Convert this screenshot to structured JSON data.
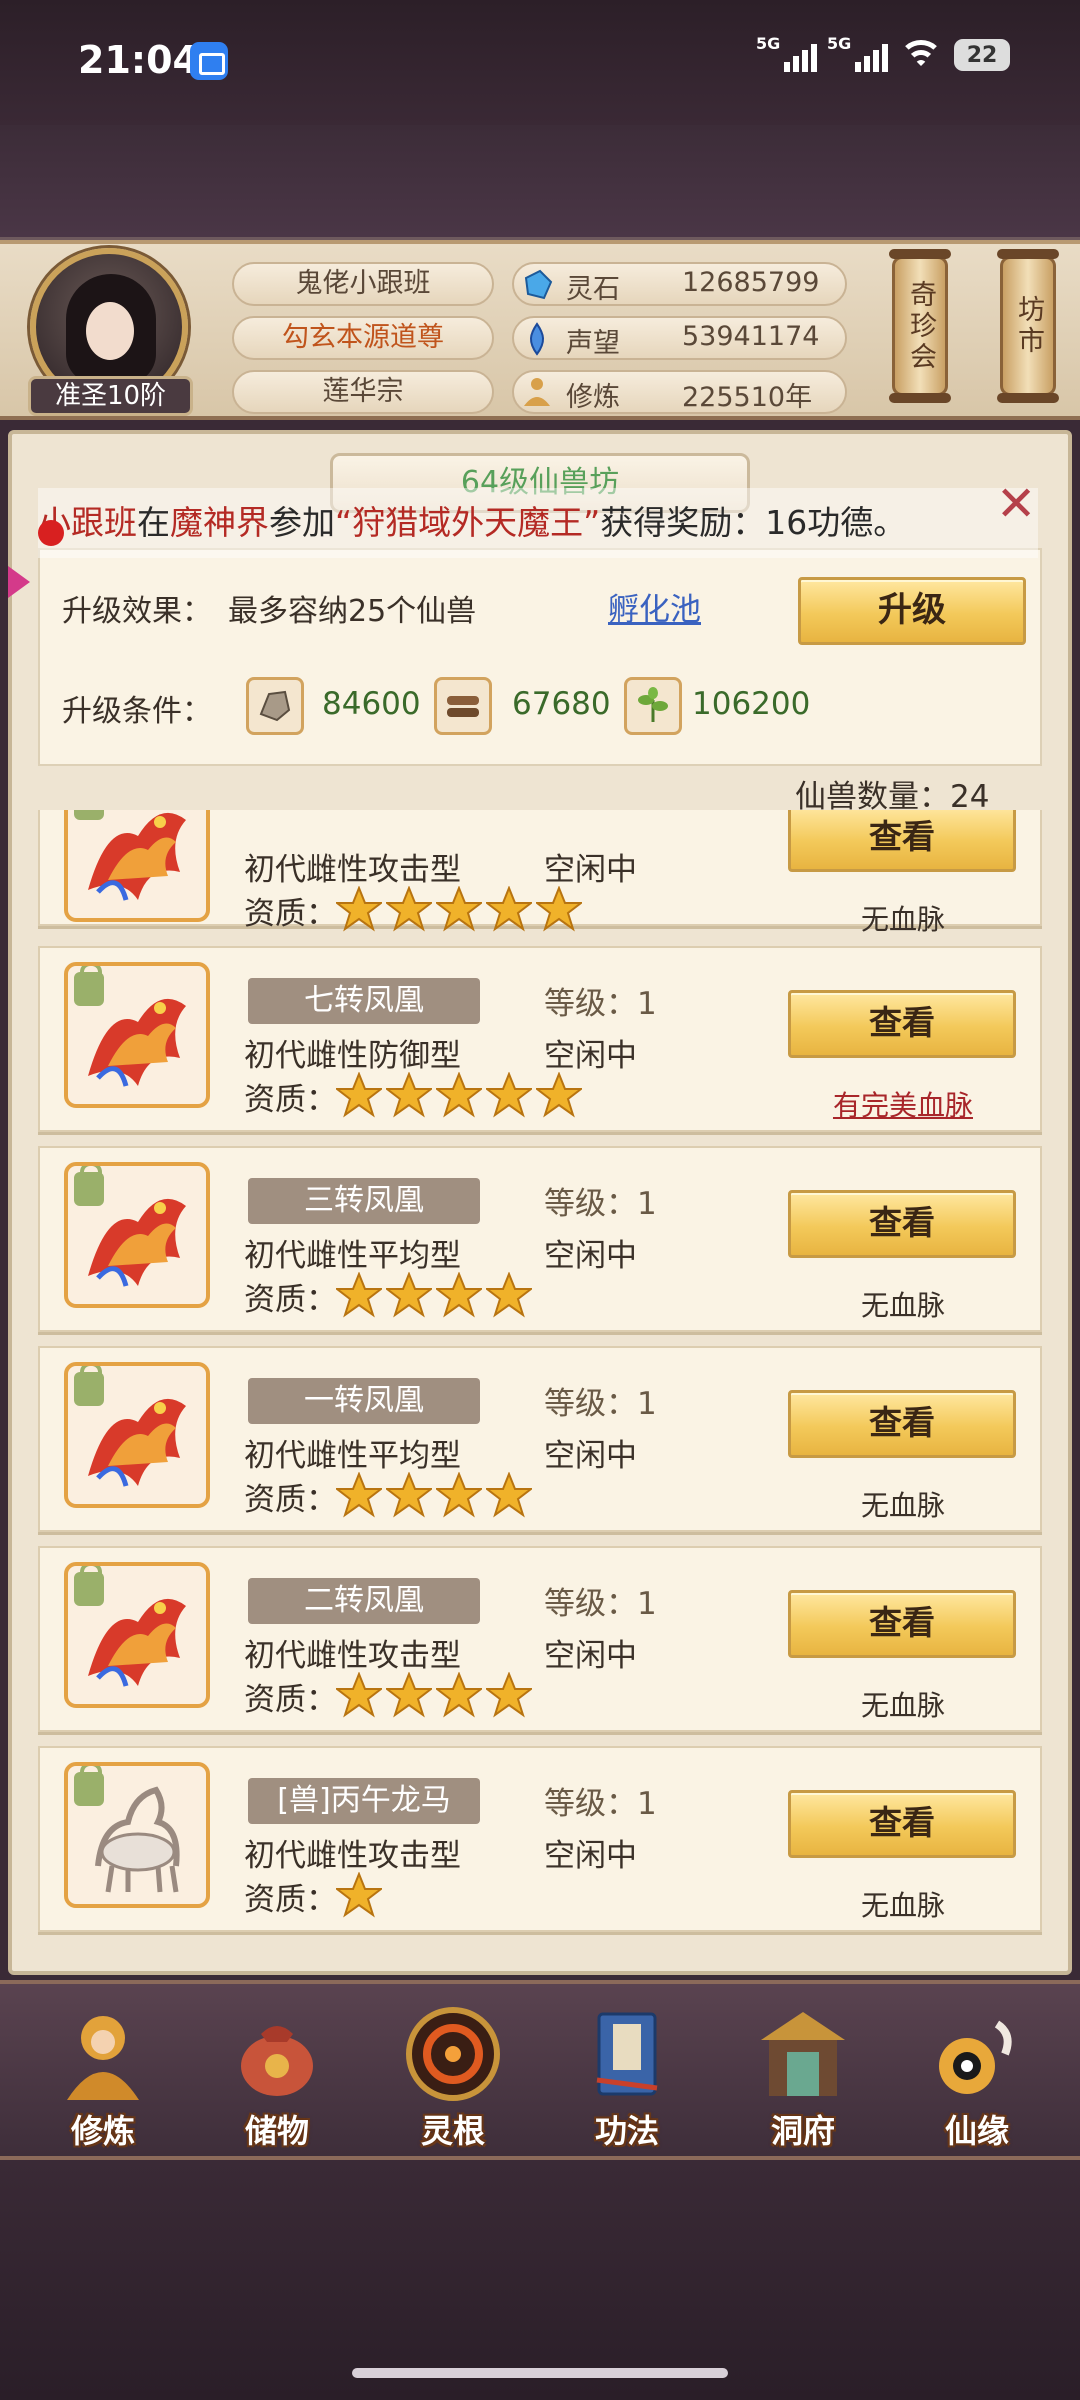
{
  "status": {
    "time": "21:04",
    "signal1": "5G",
    "signal2": "5G",
    "wifi_sub": "6",
    "battery": "22"
  },
  "header": {
    "rank": "准圣10阶",
    "names": [
      "鬼佬小跟班",
      "勾玄本源道尊",
      "莲华宗"
    ],
    "stats": [
      {
        "label": "灵石",
        "value": "12685799",
        "icon": "spirit-stone-icon"
      },
      {
        "label": "声望",
        "value": "53941174",
        "icon": "prestige-icon"
      },
      {
        "label": "修炼",
        "value": "225510年",
        "icon": "meditation-icon"
      }
    ],
    "scrolls": [
      "奇珍会",
      "坊市"
    ]
  },
  "panel": {
    "title": "64级仙兽坊",
    "marquee": {
      "p1": "小跟班",
      "p2": "在",
      "p3": "魔神界",
      "p4": "参加",
      "p5": "“狩猎域外天魔王”",
      "p6": "获得奖励：16功德。"
    },
    "upgrade_effect_label": "升级效果：",
    "upgrade_effect_text": "最多容纳25个仙兽",
    "hatch_link": "孵化池",
    "upgrade_button": "升级",
    "upgrade_cond_label": "升级条件：",
    "materials": [
      {
        "icon": "ore-icon",
        "value": "84600"
      },
      {
        "icon": "wood-icon",
        "value": "67680"
      },
      {
        "icon": "herb-icon",
        "value": "106200"
      }
    ],
    "count_label": "仙兽数量：24"
  },
  "beasts": [
    {
      "name": "",
      "type": "初代雌性攻击型",
      "level": "",
      "state": "空闲中",
      "quality_label": "资质：",
      "stars": 5,
      "view": "查看",
      "blood": "无血脉",
      "blood_perfect": false,
      "kind": "phoenix"
    },
    {
      "name": "七转凤凰",
      "type": "初代雌性防御型",
      "level": "等级：1",
      "state": "空闲中",
      "quality_label": "资质：",
      "stars": 5,
      "view": "查看",
      "blood": "有完美血脉",
      "blood_perfect": true,
      "kind": "phoenix"
    },
    {
      "name": "三转凤凰",
      "type": "初代雌性平均型",
      "level": "等级：1",
      "state": "空闲中",
      "quality_label": "资质：",
      "stars": 4,
      "view": "查看",
      "blood": "无血脉",
      "blood_perfect": false,
      "kind": "phoenix"
    },
    {
      "name": "一转凤凰",
      "type": "初代雌性平均型",
      "level": "等级：1",
      "state": "空闲中",
      "quality_label": "资质：",
      "stars": 4,
      "view": "查看",
      "blood": "无血脉",
      "blood_perfect": false,
      "kind": "phoenix"
    },
    {
      "name": "二转凤凰",
      "type": "初代雌性攻击型",
      "level": "等级：1",
      "state": "空闲中",
      "quality_label": "资质：",
      "stars": 4,
      "view": "查看",
      "blood": "无血脉",
      "blood_perfect": false,
      "kind": "phoenix"
    },
    {
      "name": "[兽]丙午龙马",
      "type": "初代雌性攻击型",
      "level": "等级：1",
      "state": "空闲中",
      "quality_label": "资质：",
      "stars": 1,
      "view": "查看",
      "blood": "无血脉",
      "blood_perfect": false,
      "kind": "dragon-horse"
    }
  ],
  "nav": [
    {
      "label": "修炼",
      "icon": "cultivate-icon"
    },
    {
      "label": "储物",
      "icon": "storage-bag-icon"
    },
    {
      "label": "灵根",
      "icon": "spirit-root-icon"
    },
    {
      "label": "功法",
      "icon": "technique-book-icon"
    },
    {
      "label": "洞府",
      "icon": "cave-mansion-icon"
    },
    {
      "label": "仙缘",
      "icon": "fortune-icon"
    }
  ],
  "colors": {
    "accent_gold": "#f3c95a",
    "link_blue": "#3a62c0",
    "blood_red": "#a8262a",
    "value_green": "#3a6a2a"
  }
}
